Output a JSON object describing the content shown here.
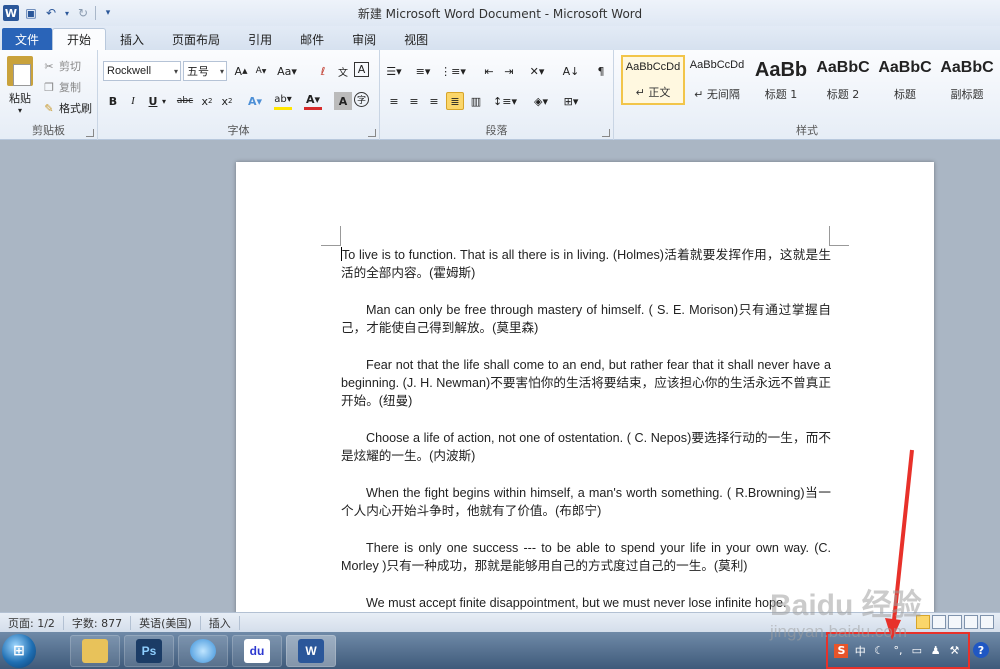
{
  "window": {
    "title": "新建 Microsoft Word Document - Microsoft Word",
    "logo": "W"
  },
  "tabs": [
    "文件",
    "开始",
    "插入",
    "页面布局",
    "引用",
    "邮件",
    "审阅",
    "视图"
  ],
  "clipboard": {
    "paste": "粘贴",
    "cut": "剪切",
    "copy": "复制",
    "format_painter": "格式刷",
    "label": "剪贴板"
  },
  "font": {
    "name": "Rockwell",
    "size": "五号",
    "label": "字体"
  },
  "paragraph": {
    "label": "段落"
  },
  "styles": {
    "label": "样式",
    "items": [
      {
        "preview": "AaBbCcDd",
        "name": "↵ 正文"
      },
      {
        "preview": "AaBbCcDd",
        "name": "↵ 无间隔"
      },
      {
        "preview": "AaBb",
        "name": "标题 1"
      },
      {
        "preview": "AaBbC",
        "name": "标题 2"
      },
      {
        "preview": "AaBbC",
        "name": "标题"
      },
      {
        "preview": "AaBbC",
        "name": "副标题"
      }
    ]
  },
  "document": {
    "paragraphs": [
      "To live is to function. That is all there is in living. (Holmes)活着就要发挥作用，这就是生活的全部内容。(霍姆斯)",
      "Man can only be free through mastery of himself. ( S. E. Morison)只有通过掌握自己，才能使自己得到解放。(莫里森)",
      "Fear not that the life shall come to an end, but rather fear that it shall never have a beginning. (J. H. Newman)不要害怕你的生活将要结束，应该担心你的生活永远不曾真正开始。(纽曼)",
      "Choose a life of action, not one of ostentation. ( C. Nepos)要选择行动的一生，而不是炫耀的一生。(内波斯)",
      "When the fight begins within himself, a man's worth something. ( R.Browning)当一个人内心开始斗争时，他就有了价值。(布郎宁)",
      "There is only one success --- to be able to spend your life in your own way. (C. Morley )只有一种成功，那就是能够用自己的方式度过自己的一生。(莫利)",
      "We must accept finite disappointment, but we must never lose infinite hope."
    ]
  },
  "status": {
    "page": "页面: 1/2",
    "words": "字数: 877",
    "language": "英语(美国)",
    "mode": "插入"
  },
  "tray": {
    "ime": "中"
  },
  "watermark": {
    "title": "Baidu 经验",
    "url": "jingyan.baidu.com"
  },
  "colors": {
    "file_tab": "#2a64b8",
    "highlight": "#e8312a"
  }
}
